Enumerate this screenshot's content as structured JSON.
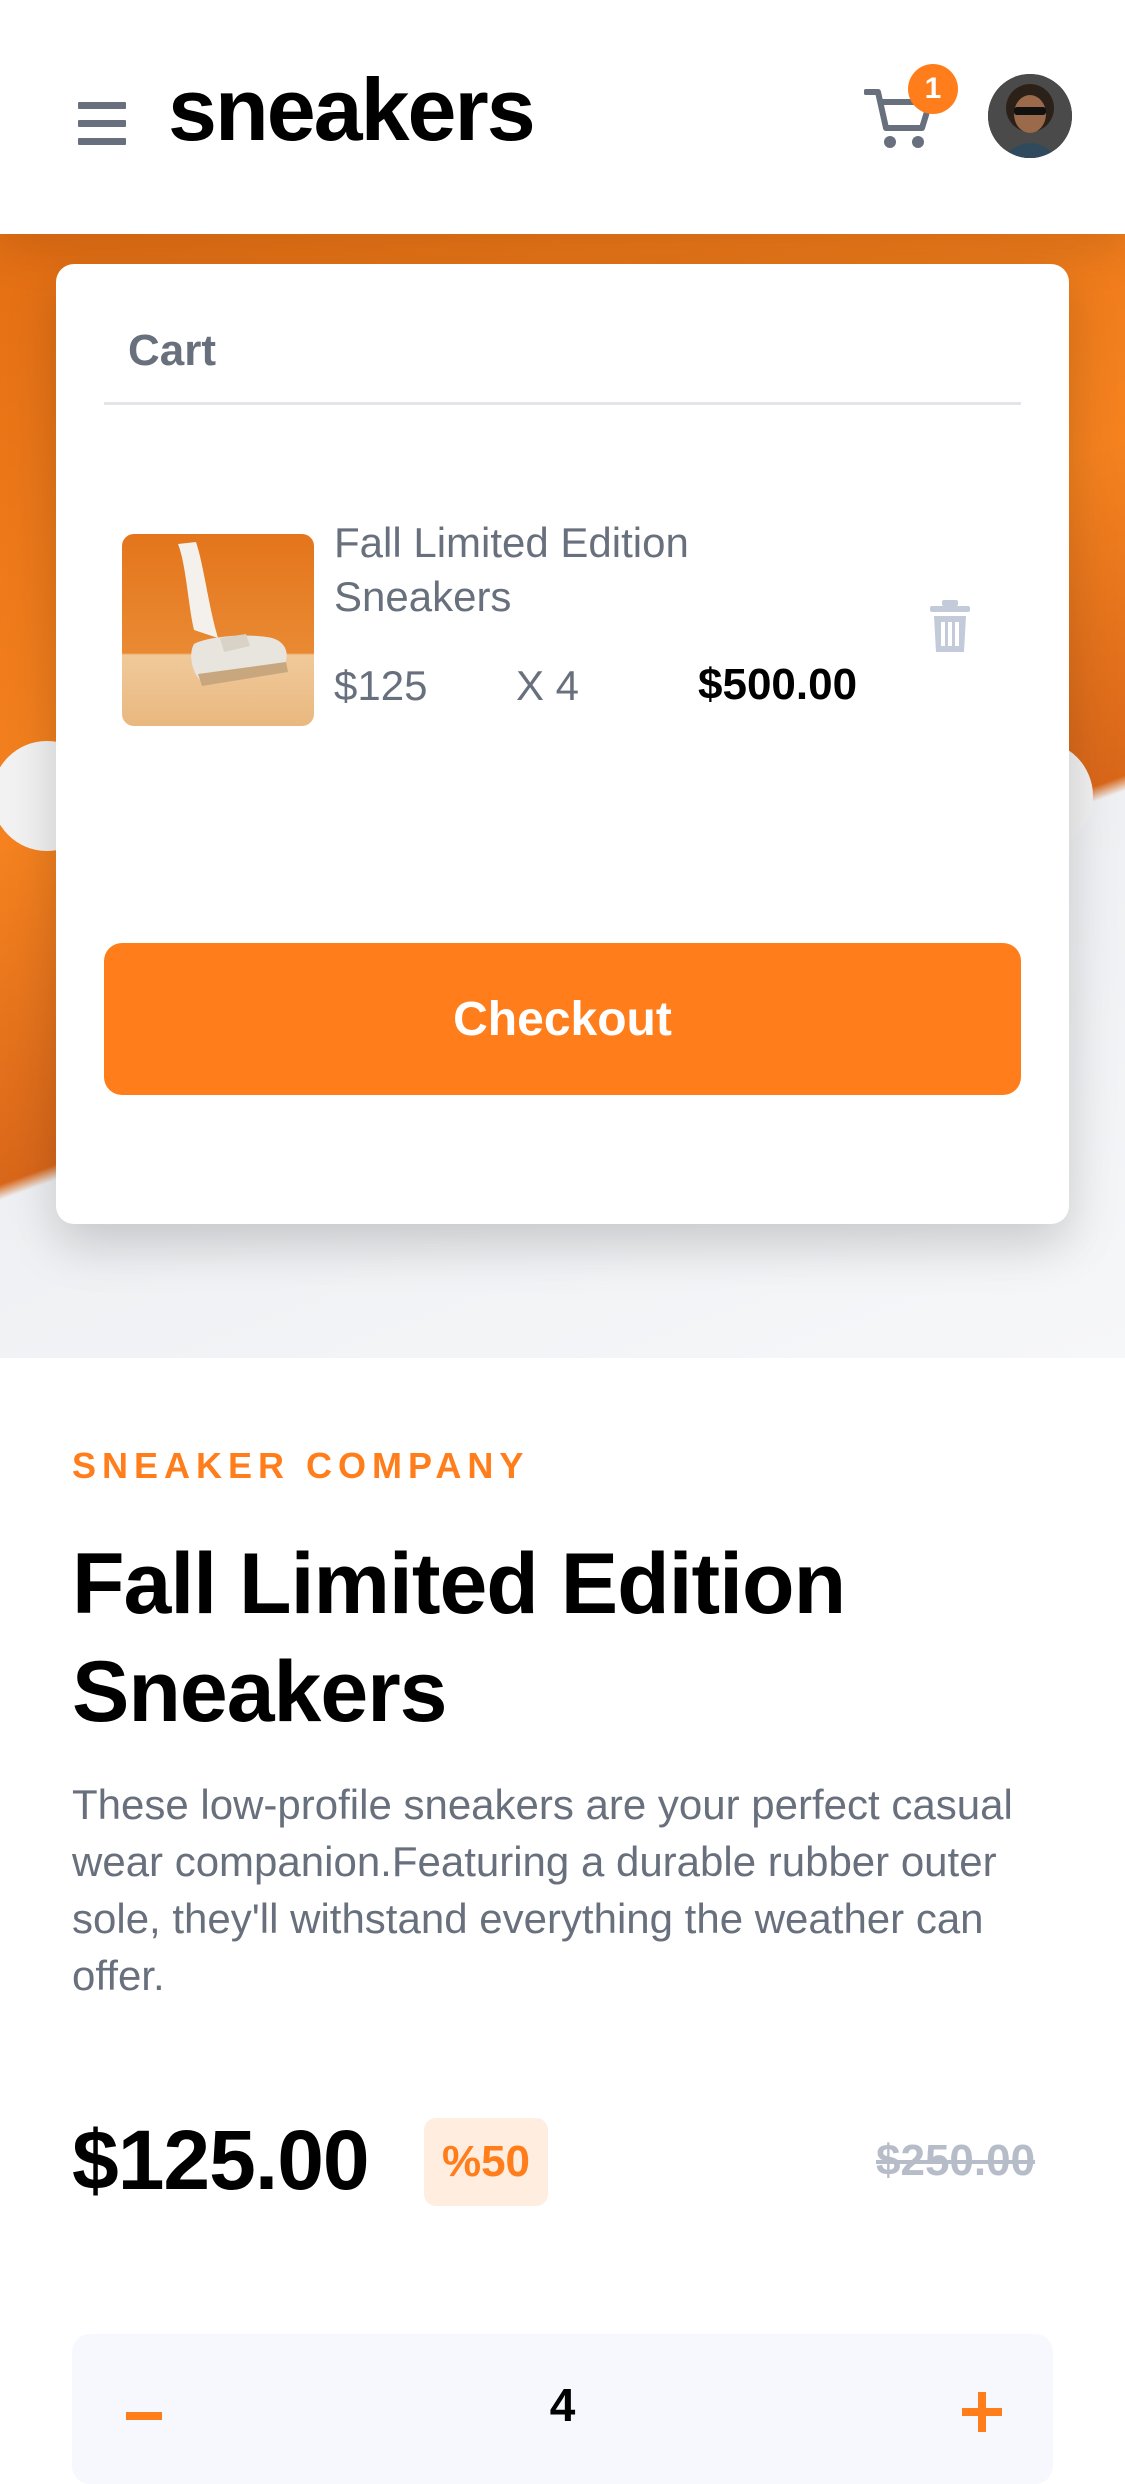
{
  "header": {
    "logo": "sneakers",
    "cart_count": "1"
  },
  "cart": {
    "title": "Cart",
    "item": {
      "name": "Fall Limited Edition Sneakers",
      "unit_price": "$125",
      "quantity": "X 4",
      "total": "$500.00"
    },
    "checkout_label": "Checkout"
  },
  "product": {
    "company": "SNEAKER COMPANY",
    "title": "Fall Limited Edition Sneakers",
    "description": "These low-profile sneakers are your perfect casual wear companion.Featuring a durable rubber outer sole, they'll withstand everything the weather can offer.",
    "price": "$125.00",
    "discount": "%50",
    "old_price": "$250.00"
  },
  "quantity": {
    "value": "4"
  },
  "colors": {
    "accent": "#ff7e1b",
    "text_muted": "#69707d",
    "badge_bg": "#ffede0"
  },
  "icons": [
    "menu-icon",
    "cart-icon",
    "trash-icon",
    "minus-icon",
    "plus-icon"
  ]
}
